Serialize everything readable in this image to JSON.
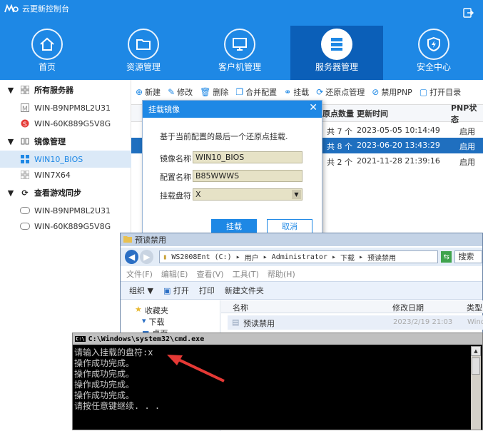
{
  "app": {
    "title": "云更新控制台"
  },
  "nav": [
    {
      "label": "首页",
      "icon": "home-icon"
    },
    {
      "label": "资源管理",
      "icon": "folder-icon"
    },
    {
      "label": "客户机管理",
      "icon": "monitor-icon"
    },
    {
      "label": "服务器管理",
      "icon": "server-icon",
      "active": true
    },
    {
      "label": "安全中心",
      "icon": "shield-icon"
    }
  ],
  "sidebar": {
    "groups": [
      {
        "label": "所有服务器",
        "items": [
          "WIN-B9NPM8L2U31",
          "WIN-60K889G5V8G"
        ]
      },
      {
        "label": "镜像管理",
        "items": [
          "WIN10_BIOS",
          "WIN7X64"
        ]
      },
      {
        "label": "查看游戏同步",
        "items": [
          "WIN-B9NPM8L2U31",
          "WIN-60K889G5V8G"
        ]
      }
    ]
  },
  "toolbar": [
    "新建",
    "修改",
    "删除",
    "合并配置",
    "挂载",
    "还原点管理",
    "禁用PNP",
    "打开目录"
  ],
  "table": {
    "headers": [
      "原点数量",
      "更新时间",
      "PNP状态"
    ],
    "rows": [
      {
        "count": "共 7 个",
        "time": "2023-05-05 10:14:49",
        "pnp": "启用"
      },
      {
        "count": "共 8 个",
        "time": "2023-06-20 13:43:29",
        "pnp": "启用"
      },
      {
        "count": "共 2 个",
        "time": "2021-11-28 21:39:16",
        "pnp": "启用"
      }
    ]
  },
  "dialog": {
    "title": "挂载镜像",
    "message": "基于当前配置的最后一个还原点挂载.",
    "fields": [
      {
        "label": "镜像名称",
        "value": "WIN10_BIOS"
      },
      {
        "label": "配置名称",
        "value": "B85WWWS"
      },
      {
        "label": "挂载盘符",
        "value": "X"
      }
    ],
    "ok": "挂载",
    "cancel": "取消"
  },
  "explorer": {
    "title": "预读禁用",
    "path": [
      "WS2008Ent (C:)",
      "用户",
      "Administrator",
      "下载",
      "预读禁用"
    ],
    "search": "搜索",
    "menu": [
      "文件(F)",
      "编辑(E)",
      "查看(V)",
      "工具(T)",
      "帮助(H)"
    ],
    "commands": [
      "组织 ▼",
      "打开",
      "打印",
      "新建文件夹"
    ],
    "tree": [
      "收藏夹",
      "下载",
      "桌面"
    ],
    "columns": [
      "名称",
      "修改日期",
      "类型"
    ],
    "file": {
      "name": "预读禁用",
      "date": "2023/2/19 21:03",
      "type": "Windo"
    }
  },
  "cmd": {
    "title": "C:\\Windows\\system32\\cmd.exe",
    "lines": [
      "请输入挂载的盘符:x",
      "操作成功完成。",
      "操作成功完成。",
      "操作成功完成。",
      "操作成功完成。",
      "请按任意键继续. . ."
    ]
  },
  "colors": {
    "primary": "#1e88e5",
    "selected": "#1f6fbf",
    "annotation": "#e53935"
  }
}
